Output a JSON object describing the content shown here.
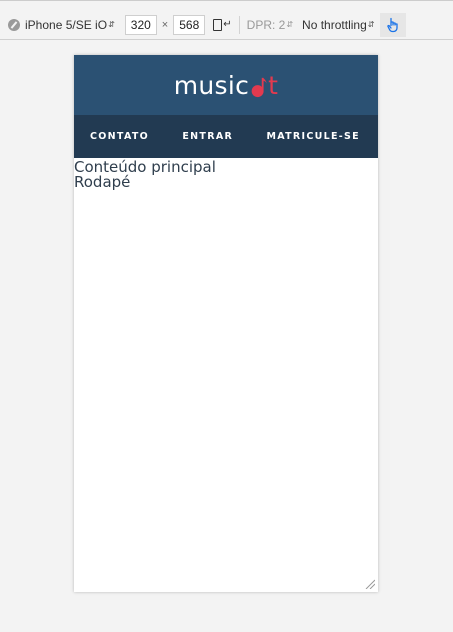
{
  "devtools": {
    "device_select": "iPhone 5/SE iO",
    "width": "320",
    "times": "×",
    "height": "568",
    "dpr": "DPR: 2",
    "throttling": "No throttling"
  },
  "site": {
    "logo_text_white": "music",
    "logo_text_t": "t",
    "nav": [
      {
        "label": "CONTATO"
      },
      {
        "label": "ENTRAR"
      },
      {
        "label": "MATRICULE-SE"
      }
    ],
    "main_content": "Conteúdo principal",
    "footer": "Rodapé"
  },
  "colors": {
    "header_bg": "#2b5173",
    "nav_bg": "#223a52",
    "logo_accent": "#e23a4f"
  }
}
